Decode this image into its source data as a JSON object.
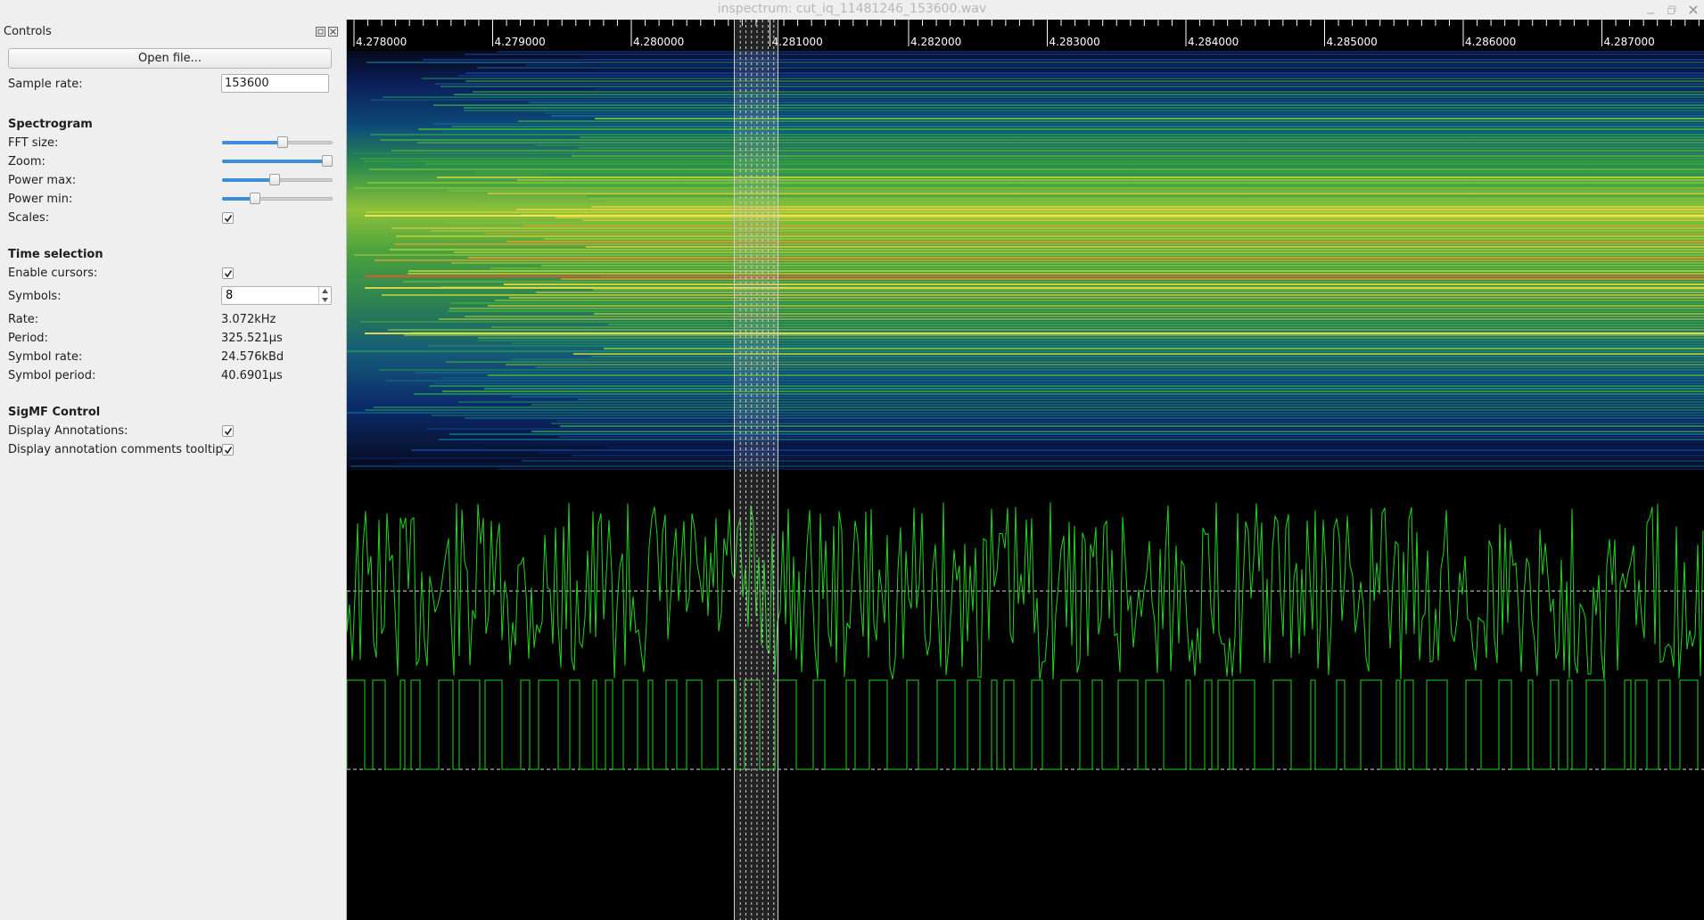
{
  "window": {
    "title": "inspectrum: cut_iq_11481246_153600.wav"
  },
  "dock": {
    "title": "Controls",
    "open_file_label": "Open file...",
    "sample_rate_label": "Sample rate:",
    "sample_rate_value": "153600",
    "spectrogram": {
      "title": "Spectrogram",
      "fft_size_label": "FFT size:",
      "fft_size_level": 0.55,
      "zoom_label": "Zoom:",
      "zoom_level": 1.0,
      "power_max_label": "Power max:",
      "power_max_level": 0.47,
      "power_min_label": "Power min:",
      "power_min_level": 0.28,
      "scales_label": "Scales:",
      "scales_checked": true
    },
    "time_selection": {
      "title": "Time selection",
      "enable_cursors_label": "Enable cursors:",
      "enable_cursors_checked": true,
      "symbols_label": "Symbols:",
      "symbols_value": "8",
      "rate_label": "Rate:",
      "rate_value": "3.072kHz",
      "period_label": "Period:",
      "period_value": "325.521µs",
      "symbol_rate_label": "Symbol rate:",
      "symbol_rate_value": "24.576kBd",
      "symbol_period_label": "Symbol period:",
      "symbol_period_value": "40.6901µs"
    },
    "sigmf": {
      "title": "SigMF Control",
      "display_annotations_label": "Display Annotations:",
      "display_annotations_checked": true,
      "tooltips_label": "Display annotation comments tooltips:",
      "tooltips_checked": true
    }
  },
  "ruler": {
    "ticks": [
      "4.278000",
      "4.279000",
      "4.280000",
      "4.281000",
      "4.282000",
      "4.283000",
      "4.284000",
      "4.285000",
      "4.286000",
      "4.287000"
    ]
  },
  "colors": {
    "accent": "#3d8ed9",
    "trace": "#1fd61f",
    "background": "#000000"
  }
}
